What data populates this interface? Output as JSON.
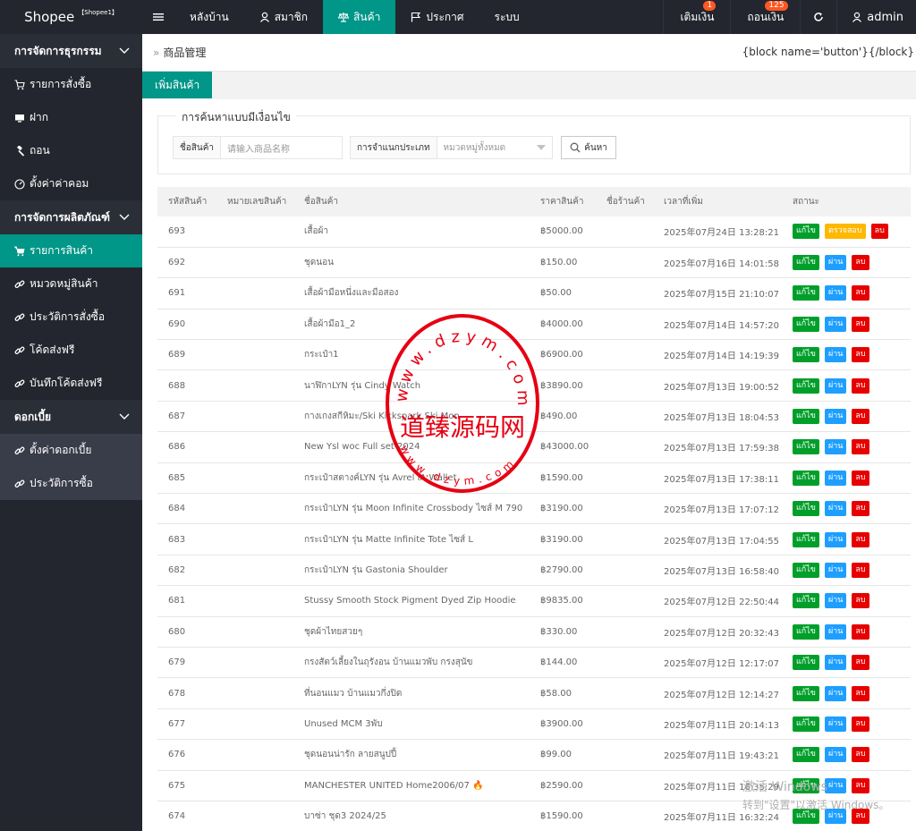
{
  "topbar": {
    "logo": "Shopee",
    "logo_badge": "【Shopee1】",
    "nav": [
      {
        "label": "หลังบ้าน",
        "icon": ""
      },
      {
        "label": "สมาชิก",
        "icon": "user-icon"
      },
      {
        "label": "สินค้า",
        "icon": "scale-icon",
        "active": true
      },
      {
        "label": "ประกาศ",
        "icon": "flag-icon"
      },
      {
        "label": "ระบบ",
        "icon": ""
      }
    ],
    "topup_label": "เติมเงิน",
    "topup_badge": "1",
    "withdraw_label": "ถอนเงิน",
    "withdraw_badge": "125",
    "user_label": "admin"
  },
  "sidebar": {
    "group1": "การจัดการธุรกรรม",
    "group1_items": [
      "รายการสั่งซื้อ",
      "ฝาก",
      "ถอน",
      "ตั้งค่าค่าคอม"
    ],
    "group2": "การจัดการผลิตภัณฑ์",
    "group2_items": [
      "รายการสินค้า",
      "หมวดหมู่สินค้า",
      "ประวัติการสั่งซื้อ",
      "โค้ดส่งฟรี",
      "บันทึกโค้ดส่งฟรี"
    ],
    "group3": "ดอกเบี้ย",
    "group3_items": [
      "ตั้งค่าดอกเบี้ย",
      "ประวัติการซื้อ"
    ]
  },
  "breadcrumb": {
    "current": "商品管理",
    "right_text": "{block name='button'}{/block}"
  },
  "tabs": {
    "add_product": "เพิ่มสินค้า"
  },
  "search": {
    "legend": "การค้นหาแบบมีเงื่อนไข",
    "name_label": "ชื่อสินค้า",
    "name_placeholder": "请输入商品名称",
    "category_label": "การจำแนกประเภท",
    "category_value": "หมวดหมู่ทั้งหมด",
    "button_label": "ค้นหา"
  },
  "table": {
    "headers": [
      "รหัสสินค้า",
      "หมายเลขสินค้า",
      "ชื่อสินค้า",
      "ราคาสินค้า",
      "ชื่อร้านค้า",
      "เวลาที่เพิ่ม",
      "สถานะ"
    ],
    "action_labels": {
      "edit": "แก้ไข",
      "review": "ตรวจสอบ",
      "pass": "ผ่าน",
      "delete": "ลบ"
    },
    "rows": [
      {
        "id": "693",
        "number": "",
        "name": "เสื้อผ้า",
        "price": "฿5000.00",
        "shop": "",
        "time": "2025年07月24日 13:28:21",
        "status": "review"
      },
      {
        "id": "692",
        "number": "",
        "name": "ชุดนอน",
        "price": "฿150.00",
        "shop": "",
        "time": "2025年07月16日 14:01:58",
        "status": "pass"
      },
      {
        "id": "691",
        "number": "",
        "name": "เสื้อผ้ามือหนึ่งและมือสอง",
        "price": "฿50.00",
        "shop": "",
        "time": "2025年07月15日 21:10:07",
        "status": "pass"
      },
      {
        "id": "690",
        "number": "",
        "name": "เสื้อผ้ามือ1_2",
        "price": "฿4000.00",
        "shop": "",
        "time": "2025年07月14日 14:57:20",
        "status": "pass"
      },
      {
        "id": "689",
        "number": "",
        "name": "กระเป๋า1",
        "price": "฿6900.00",
        "shop": "",
        "time": "2025年07月14日 14:19:39",
        "status": "pass"
      },
      {
        "id": "688",
        "number": "",
        "name": "นาฬิกาLYN รุ่น Cindy Watch",
        "price": "฿3890.00",
        "shop": "",
        "time": "2025年07月13日 19:00:52",
        "status": "pass"
      },
      {
        "id": "687",
        "number": "",
        "name": "กางเกงสกีหิมะ/Ski Kickspark Ski Mon",
        "price": "฿490.00",
        "shop": "",
        "time": "2025年07月13日 18:04:53",
        "status": "pass"
      },
      {
        "id": "686",
        "number": "",
        "name": "New Ysl woc  Full set 2024",
        "price": "฿43000.00",
        "shop": "",
        "time": "2025年07月13日 17:59:38",
        "status": "pass"
      },
      {
        "id": "685",
        "number": "",
        "name": "กระเป๋าสตางค์LYN รุ่น Avrel IA Wallet",
        "price": "฿1590.00",
        "shop": "",
        "time": "2025年07月13日 17:38:11",
        "status": "pass"
      },
      {
        "id": "684",
        "number": "",
        "name": "กระเป๋าLYN รุ่น Moon Infinite Crossbody ไซส์ M 790",
        "price": "฿3190.00",
        "shop": "",
        "time": "2025年07月13日 17:07:12",
        "status": "pass"
      },
      {
        "id": "683",
        "number": "",
        "name": "กระเป๋าLYN รุ่น Matte Infinite Tote ไซส์ L",
        "price": "฿3190.00",
        "shop": "",
        "time": "2025年07月13日 17:04:55",
        "status": "pass"
      },
      {
        "id": "682",
        "number": "",
        "name": "กระเป๋าLYN รุ่น Gastonia Shoulder",
        "price": "฿2790.00",
        "shop": "",
        "time": "2025年07月13日 16:58:40",
        "status": "pass"
      },
      {
        "id": "681",
        "number": "",
        "name": "Stussy Smooth Stock Pigment Dyed Zip Hoodie",
        "price": "฿9835.00",
        "shop": "",
        "time": "2025年07月12日 22:50:44",
        "status": "pass"
      },
      {
        "id": "680",
        "number": "",
        "name": "ชุดผ้าไทยสวยๆ",
        "price": "฿330.00",
        "shop": "",
        "time": "2025年07月12日 20:32:43",
        "status": "pass"
      },
      {
        "id": "679",
        "number": "",
        "name": "กรงสัตว์เลี้ยงในถุรังอน บ้านแมวพับ กรงสุนัข",
        "price": "฿144.00",
        "shop": "",
        "time": "2025年07月12日 12:17:07",
        "status": "pass"
      },
      {
        "id": "678",
        "number": "",
        "name": "ที่นอนแมว บ้านแมวกึ่งปิด",
        "price": "฿58.00",
        "shop": "",
        "time": "2025年07月12日 12:14:27",
        "status": "pass"
      },
      {
        "id": "677",
        "number": "",
        "name": "Unused MCM 3พับ",
        "price": "฿3900.00",
        "shop": "",
        "time": "2025年07月11日 20:14:13",
        "status": "pass"
      },
      {
        "id": "676",
        "number": "",
        "name": "ชุดนอนน่ารัก ลายสนูปปี้",
        "price": "฿99.00",
        "shop": "",
        "time": "2025年07月11日 19:43:21",
        "status": "pass"
      },
      {
        "id": "675",
        "number": "",
        "name": "MANCHESTER UNITED Home2006/07 🔥",
        "price": "฿2590.00",
        "shop": "",
        "time": "2025年07月11日 16:35:29",
        "status": "pass"
      },
      {
        "id": "674",
        "number": "",
        "name": "บาซ่า ชุด3 2024/25",
        "price": "฿1590.00",
        "shop": "",
        "time": "2025年07月11日 16:32:24",
        "status": "pass"
      }
    ]
  },
  "watermark": {
    "title": "道臻源码网",
    "ring_text": "www.dzym.com"
  },
  "os_overlay": {
    "line1": "激活 Windows",
    "line2": "转到\"设置\"以激活 Windows。"
  },
  "colors": {
    "teal": "#009688",
    "dark": "#23262e",
    "edit": "#009f2a",
    "pass": "#1e9fff",
    "review": "#ffb800",
    "delete": "#e60000",
    "watermark": "#e60012"
  }
}
